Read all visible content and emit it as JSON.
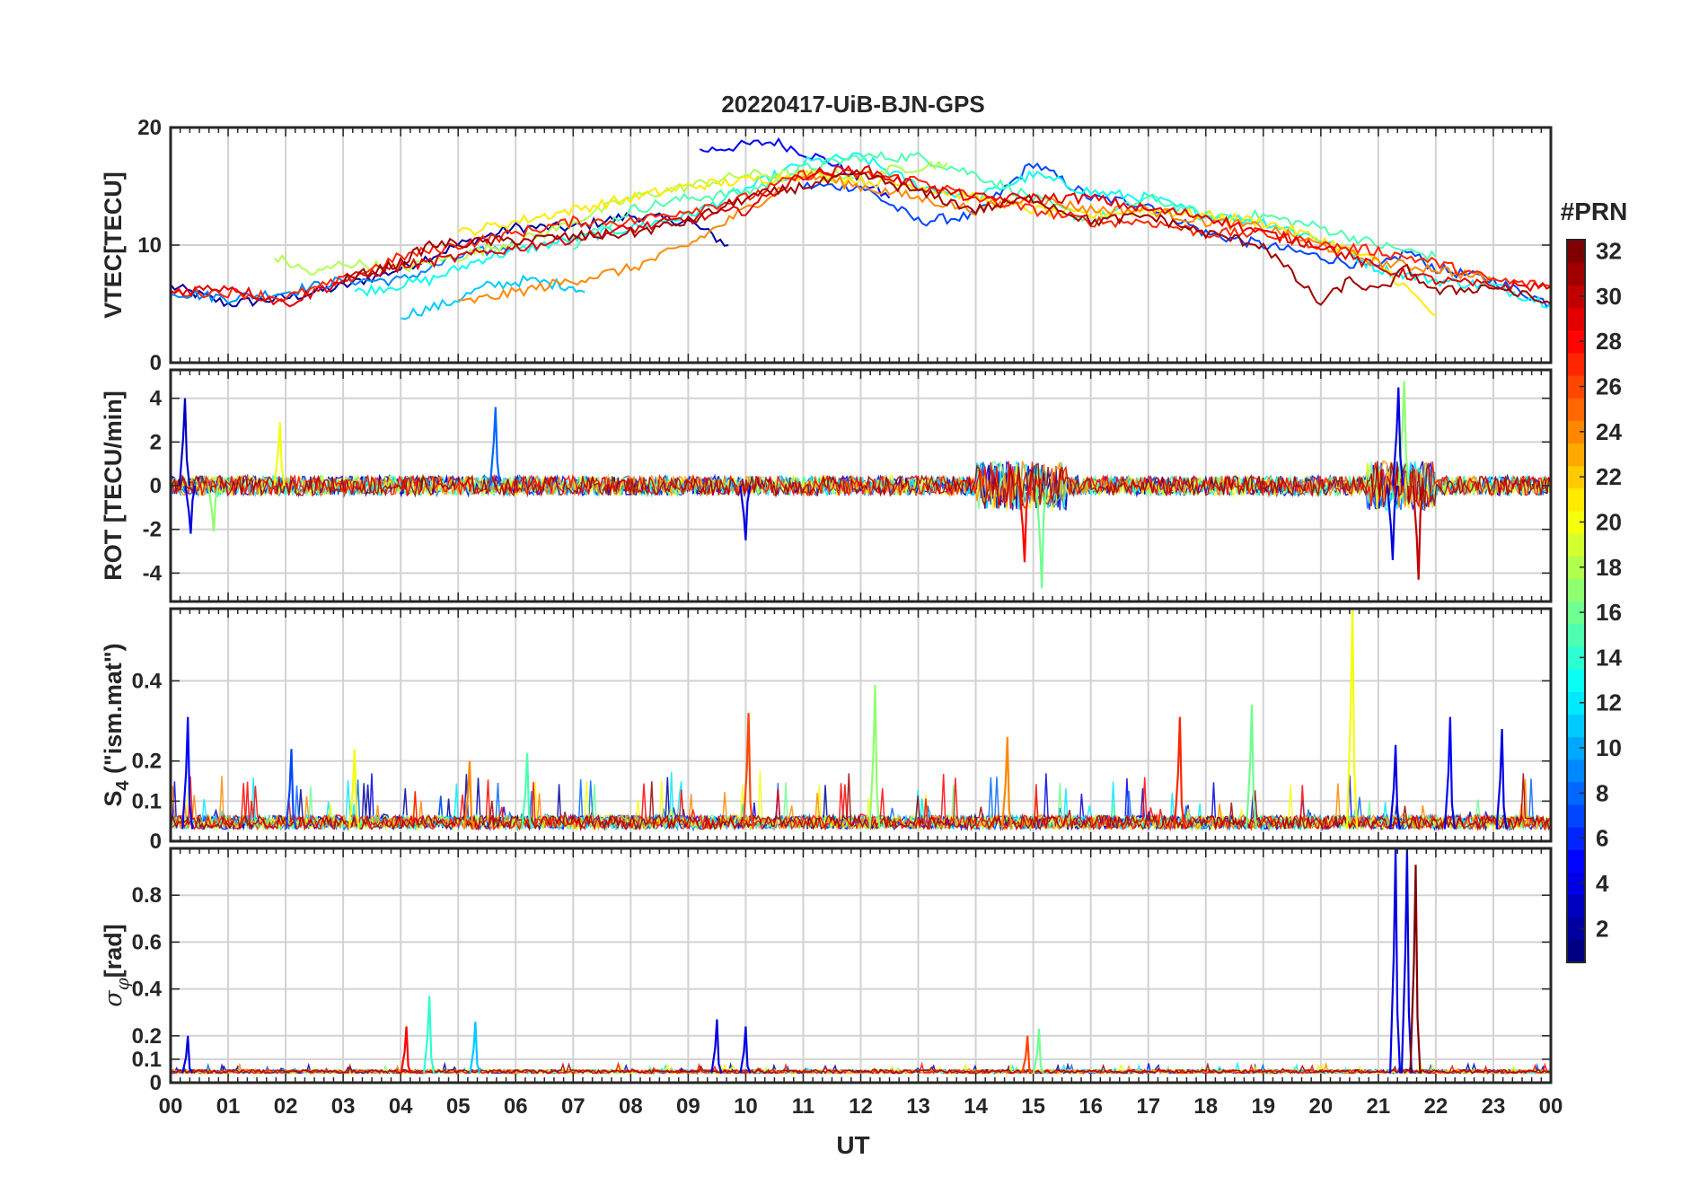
{
  "title": "20220417-UiB-BJN-GPS",
  "x_axis": {
    "label": "UT",
    "ticks": [
      "00",
      "01",
      "02",
      "03",
      "04",
      "05",
      "06",
      "07",
      "08",
      "09",
      "10",
      "11",
      "12",
      "13",
      "14",
      "15",
      "16",
      "17",
      "18",
      "19",
      "20",
      "21",
      "22",
      "23",
      "00"
    ],
    "range_hours": [
      0,
      24
    ]
  },
  "colorbar": {
    "label": "#PRN",
    "ticks": [
      "2",
      "4",
      "6",
      "8",
      "10",
      "12",
      "14",
      "16",
      "18",
      "20",
      "22",
      "24",
      "26",
      "28",
      "30",
      "32"
    ],
    "range": [
      1,
      32
    ],
    "colormap": "jet"
  },
  "chart_data": [
    {
      "type": "line",
      "panel": "vtec",
      "ylabel": "VTEC[TECU]",
      "ylim": [
        0,
        20
      ],
      "yticks": [
        "0",
        "10",
        "20"
      ],
      "grid": true,
      "series": [
        {
          "prn": 2,
          "x": [
            0,
            1,
            2,
            3,
            4,
            5,
            6,
            7,
            8,
            9,
            9.7
          ],
          "y": [
            6.5,
            5,
            5.5,
            6.5,
            8,
            10,
            11.5,
            11.5,
            12.5,
            12,
            10
          ]
        },
        {
          "prn": 5,
          "x": [
            9.2,
            10,
            10.5,
            11.5,
            12.5
          ],
          "y": [
            18,
            18.5,
            18.8,
            17,
            14
          ]
        },
        {
          "prn": 7,
          "x": [
            11,
            12,
            13,
            14,
            15,
            16,
            17,
            18,
            19,
            20,
            21,
            21.5,
            22,
            23,
            24
          ],
          "y": [
            15,
            15,
            12,
            12.5,
            17,
            14,
            13.5,
            11,
            10,
            9,
            8,
            9.5,
            8,
            7,
            5
          ]
        },
        {
          "prn": 9,
          "x": [
            0,
            1,
            2,
            3,
            4,
            5,
            6
          ],
          "y": [
            6,
            5.5,
            6,
            7,
            7,
            9,
            10
          ]
        },
        {
          "prn": 11,
          "x": [
            4,
            4.8,
            5.5,
            6.2,
            7,
            7.2
          ],
          "y": [
            4,
            5,
            6.5,
            7,
            6.5,
            6
          ]
        },
        {
          "prn": 13,
          "x": [
            3.2,
            4.5,
            5.5,
            7,
            9,
            11,
            12,
            13,
            14,
            15,
            16,
            17,
            18,
            19,
            20,
            21,
            22,
            23,
            24
          ],
          "y": [
            6,
            7,
            9,
            10.5,
            12.5,
            17,
            17.5,
            15,
            14,
            16,
            14.5,
            14,
            12.5,
            12,
            10.5,
            8,
            7,
            6.5,
            5
          ]
        },
        {
          "prn": 15,
          "x": [
            7,
            8,
            9,
            10,
            11,
            12,
            13,
            14,
            15,
            16,
            17,
            18,
            19,
            20,
            21,
            22
          ],
          "y": [
            10,
            13,
            14,
            14.5,
            16.5,
            17.5,
            17.5,
            16,
            14,
            12,
            14,
            12.5,
            12.5,
            11.5,
            10,
            9
          ]
        },
        {
          "prn": 18,
          "x": [
            1.8,
            2.5,
            3,
            4,
            5,
            6.5,
            8,
            10,
            12,
            13.5
          ],
          "y": [
            9,
            7.5,
            8.5,
            8,
            9,
            11,
            14,
            16,
            16,
            17
          ]
        },
        {
          "prn": 21,
          "x": [
            5,
            6,
            7,
            8,
            9,
            10,
            11,
            12,
            13,
            14,
            15,
            16,
            17,
            18,
            19,
            20,
            21,
            22
          ],
          "y": [
            11,
            12,
            13,
            14,
            15,
            15.5,
            16,
            15.5,
            15,
            14,
            13,
            12.5,
            13,
            12.5,
            12,
            10.5,
            8.5,
            4
          ]
        },
        {
          "prn": 24,
          "x": [
            5,
            6,
            7,
            8,
            9,
            10,
            11,
            12,
            13,
            14,
            15,
            16,
            17,
            18,
            19,
            20,
            21,
            22,
            23
          ],
          "y": [
            5,
            6,
            7,
            8,
            10,
            13,
            16,
            15,
            14,
            13,
            14,
            13,
            13,
            12,
            11.5,
            10,
            8.5,
            8,
            7
          ]
        },
        {
          "prn": 27,
          "x": [
            0,
            1,
            2,
            3,
            4,
            5,
            6,
            7,
            8,
            9,
            10,
            10.5,
            11,
            12,
            13,
            14,
            15,
            16,
            17,
            18,
            19,
            20,
            21,
            22,
            23,
            24
          ],
          "y": [
            6,
            6,
            5.5,
            7,
            9,
            10,
            11,
            12,
            12,
            13,
            14,
            15,
            16,
            16,
            15.5,
            14,
            13,
            12,
            12,
            11,
            11,
            10,
            9.5,
            8.5,
            7,
            6.5
          ]
        },
        {
          "prn": 29,
          "x": [
            0,
            1,
            2,
            3,
            3.8,
            10,
            11,
            12,
            13,
            14,
            15,
            16,
            17,
            18,
            19,
            20,
            21,
            22,
            23,
            24
          ],
          "y": [
            6,
            6.5,
            5,
            7,
            8,
            13,
            16,
            16.5,
            15,
            14,
            14,
            14,
            13,
            12.5,
            11,
            10,
            8,
            7,
            6.5,
            6.5
          ]
        },
        {
          "prn": 31,
          "x": [
            3,
            4,
            4.5,
            8,
            9,
            10,
            11,
            12,
            13,
            14,
            15,
            16,
            17,
            18,
            19,
            20,
            20.5,
            21,
            21.5,
            22,
            23,
            24
          ],
          "y": [
            7,
            8.5,
            10,
            11,
            12,
            14,
            15,
            16,
            14.5,
            13,
            14,
            12,
            12.5,
            11,
            10,
            5,
            7,
            6,
            8,
            6,
            6.5,
            5
          ]
        }
      ]
    },
    {
      "type": "line",
      "panel": "rot",
      "ylabel": "ROT [TECU/min]",
      "ylim": [
        -5.3,
        5.3
      ],
      "yticks": [
        "-4",
        "-2",
        "0",
        "2",
        "4"
      ],
      "grid": true,
      "events": [
        {
          "prn": 3,
          "x": 0.25,
          "y": 4.0
        },
        {
          "prn": 4,
          "x": 0.35,
          "y": -2.2
        },
        {
          "prn": 20,
          "x": 1.9,
          "y": 2.9
        },
        {
          "prn": 17,
          "x": 0.75,
          "y": -2.1
        },
        {
          "prn": 8,
          "x": 5.65,
          "y": 3.6
        },
        {
          "prn": 4,
          "x": 10.0,
          "y": -2.5
        },
        {
          "prn": 16,
          "x": 15.15,
          "y": -4.7
        },
        {
          "prn": 28,
          "x": 14.85,
          "y": -3.5
        },
        {
          "prn": 17,
          "x": 21.45,
          "y": 4.8
        },
        {
          "prn": 4,
          "x": 21.35,
          "y": 4.5
        },
        {
          "prn": 30,
          "x": 21.7,
          "y": -4.3
        },
        {
          "prn": 4,
          "x": 21.25,
          "y": -3.4
        }
      ]
    },
    {
      "type": "line",
      "panel": "s4",
      "ylabel": "S_4 (\"ism.mat\")",
      "ylim": [
        0,
        0.58
      ],
      "yticks": [
        "0",
        "0.1",
        "0.2",
        "0.4"
      ],
      "grid": true,
      "events": [
        {
          "prn": 5,
          "x": 0.3,
          "y": 0.31
        },
        {
          "prn": 7,
          "x": 2.1,
          "y": 0.23
        },
        {
          "prn": 20,
          "x": 3.2,
          "y": 0.23
        },
        {
          "prn": 24,
          "x": 5.2,
          "y": 0.2
        },
        {
          "prn": 15,
          "x": 6.2,
          "y": 0.22
        },
        {
          "prn": 26,
          "x": 10.05,
          "y": 0.32
        },
        {
          "prn": 17,
          "x": 12.25,
          "y": 0.39
        },
        {
          "prn": 24,
          "x": 14.55,
          "y": 0.26
        },
        {
          "prn": 27,
          "x": 17.55,
          "y": 0.31
        },
        {
          "prn": 16,
          "x": 18.8,
          "y": 0.34
        },
        {
          "prn": 20,
          "x": 20.55,
          "y": 0.59
        },
        {
          "prn": 4,
          "x": 21.3,
          "y": 0.24
        },
        {
          "prn": 5,
          "x": 22.25,
          "y": 0.31
        },
        {
          "prn": 4,
          "x": 23.15,
          "y": 0.28
        }
      ]
    },
    {
      "type": "line",
      "panel": "sigma_phi",
      "ylabel": "σ_φ[rad]",
      "ylim": [
        0,
        1.0
      ],
      "yticks": [
        "0",
        "0.1",
        "0.2",
        "0.4",
        "0.6",
        "0.8"
      ],
      "grid": true,
      "events": [
        {
          "prn": 4,
          "x": 0.3,
          "y": 0.2
        },
        {
          "prn": 28,
          "x": 4.1,
          "y": 0.24
        },
        {
          "prn": 14,
          "x": 4.5,
          "y": 0.37
        },
        {
          "prn": 11,
          "x": 5.3,
          "y": 0.26
        },
        {
          "prn": 4,
          "x": 9.5,
          "y": 0.27
        },
        {
          "prn": 4,
          "x": 10.0,
          "y": 0.24
        },
        {
          "prn": 26,
          "x": 14.9,
          "y": 0.2
        },
        {
          "prn": 16,
          "x": 15.1,
          "y": 0.23
        },
        {
          "prn": 4,
          "x": 21.3,
          "y": 1.0
        },
        {
          "prn": 4,
          "x": 21.5,
          "y": 1.0
        },
        {
          "prn": 32,
          "x": 21.65,
          "y": 0.93
        }
      ]
    }
  ]
}
